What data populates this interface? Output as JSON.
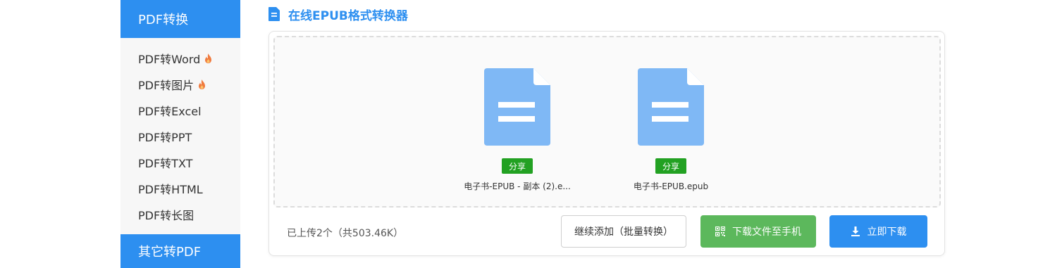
{
  "sidebar": {
    "header": "PDF转换",
    "items": [
      {
        "label": "PDF转Word",
        "hot": true
      },
      {
        "label": "PDF转图片",
        "hot": true
      },
      {
        "label": "PDF转Excel",
        "hot": false
      },
      {
        "label": "PDF转PPT",
        "hot": false
      },
      {
        "label": "PDF转TXT",
        "hot": false
      },
      {
        "label": "PDF转HTML",
        "hot": false
      },
      {
        "label": "PDF转长图",
        "hot": false
      }
    ],
    "footer": "其它转PDF"
  },
  "page": {
    "title": "在线EPUB格式转换器"
  },
  "files": [
    {
      "share_label": "分享",
      "name": "电子书-EPUB - 副本 (2).e..."
    },
    {
      "share_label": "分享",
      "name": "电子书-EPUB.epub"
    }
  ],
  "footer": {
    "upload_info": "已上传2个（共503.46K）",
    "add_button": "继续添加（批量转换）",
    "phone_button": "下载文件至手机",
    "download_button": "立即下载"
  },
  "colors": {
    "primary": "#2d8ff0",
    "green": "#5cb85c",
    "share_green": "#22a122",
    "file_icon": "#7fb8f5",
    "hot_icon": "#f07b3f"
  }
}
